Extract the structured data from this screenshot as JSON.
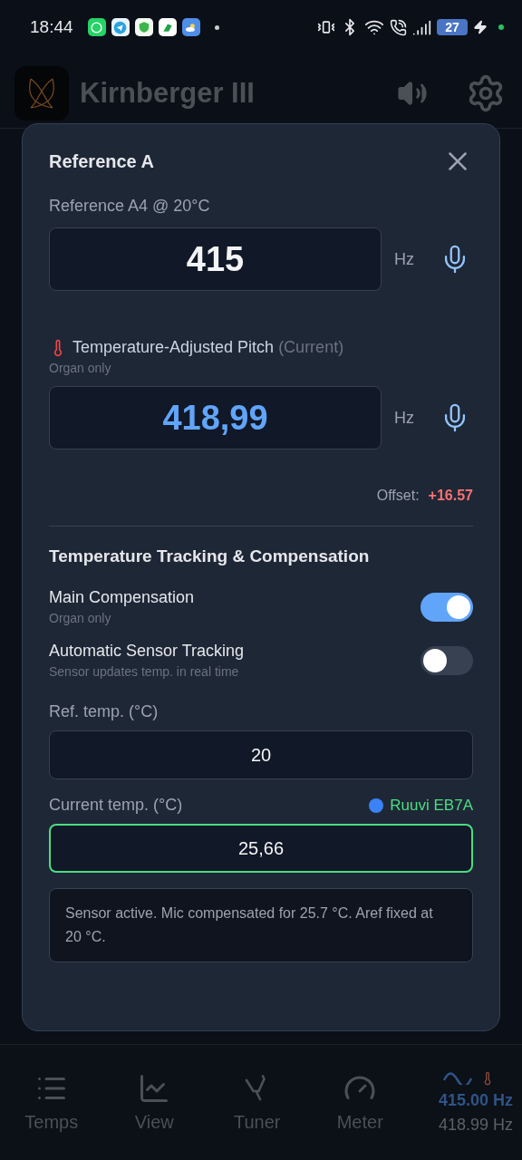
{
  "status_bar": {
    "time": "18:44",
    "battery": "27"
  },
  "header": {
    "title": "Kirnberger III"
  },
  "dialog": {
    "title": "Reference A",
    "reference": {
      "label": "Reference A4 @ 20°C",
      "value": "415",
      "unit": "Hz"
    },
    "adjusted": {
      "label": "Temperature-Adjusted Pitch",
      "note": "(Current)",
      "sublabel": "Organ only",
      "value": "418,99",
      "unit": "Hz"
    },
    "offset": {
      "label": "Offset:",
      "value": "+16.57"
    },
    "section_title": "Temperature Tracking & Compensation",
    "toggles": [
      {
        "label": "Main Compensation",
        "sublabel": "Organ only",
        "on": true
      },
      {
        "label": "Automatic Sensor Tracking",
        "sublabel": "Sensor updates temp. in real time",
        "on": false
      }
    ],
    "ref_temp": {
      "label": "Ref. temp. (°C)",
      "value": "20"
    },
    "current_temp": {
      "label": "Current temp. (°C)",
      "sensor": "Ruuvi EB7A",
      "sensor_linked": true,
      "value": "25,66"
    },
    "info": "Sensor active. Mic compensated for 25.7 °C. Aref fixed at 20 °C."
  },
  "bottom_nav": {
    "items": [
      {
        "label": "Temps"
      },
      {
        "label": "View"
      },
      {
        "label": "Tuner"
      },
      {
        "label": "Meter"
      }
    ],
    "reference_hz": "415.00 Hz",
    "current_hz": "418.99 Hz"
  }
}
